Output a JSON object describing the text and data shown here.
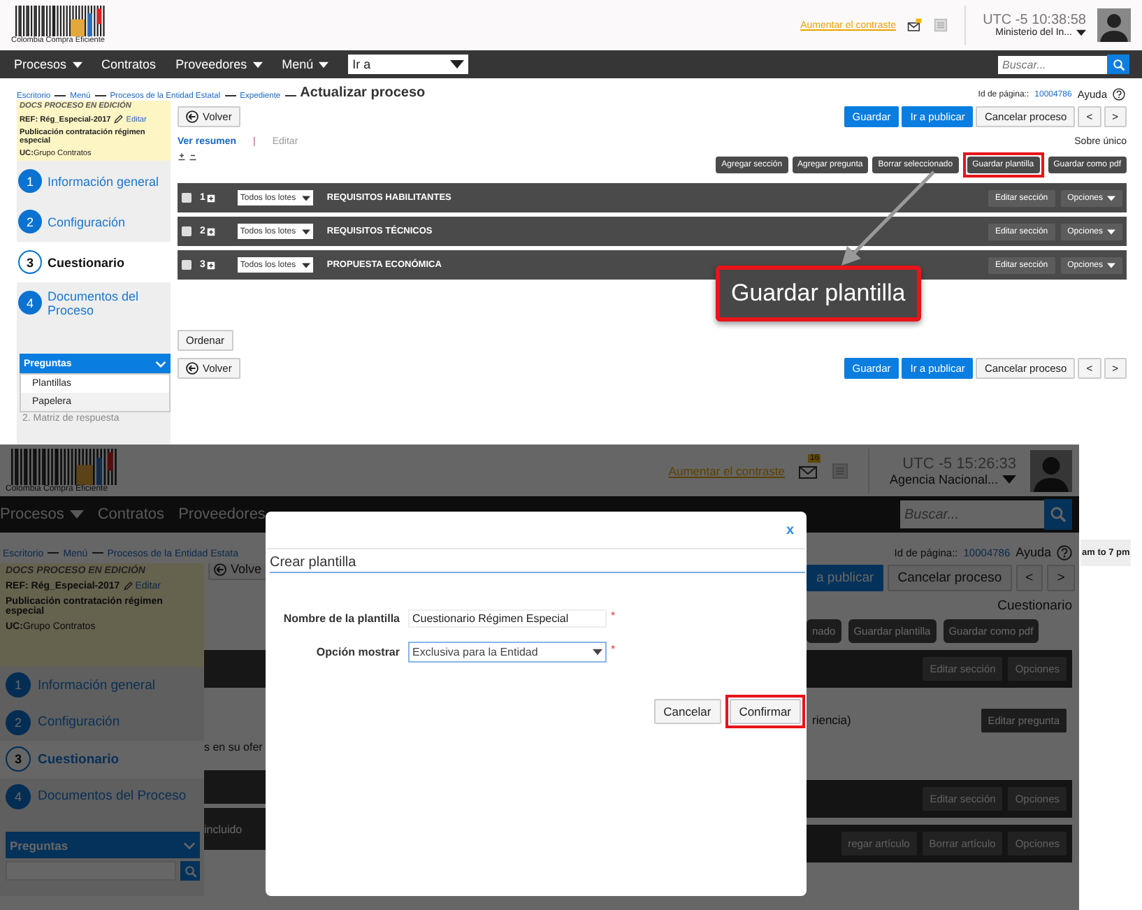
{
  "top": {
    "header": {
      "logo_text": "Colombia Compra Eficiente",
      "contrast_link": "Aumentar el contraste",
      "time": "UTC -5 10:38:58",
      "account": "Ministerio del In..."
    },
    "nav": {
      "items": [
        {
          "label": "Procesos",
          "dropdown": true
        },
        {
          "label": "Contratos",
          "dropdown": false
        },
        {
          "label": "Proveedores",
          "dropdown": true
        },
        {
          "label": "Menú",
          "dropdown": true
        }
      ],
      "goto": "Ir a",
      "search_placeholder": "Buscar..."
    },
    "breadcrumb": [
      "Escritorio",
      "Menú",
      "Procesos de la Entidad Estatal",
      "Expediente"
    ],
    "page_title": "Actualizar proceso",
    "page_id_label": "Id de página::",
    "page_id": "10004786",
    "help": "Ayuda",
    "process": {
      "status": "DOCS PROCESO EN EDICIÓN",
      "ref": "REF: Rég_Especial-2017",
      "edit": "Editar",
      "name": "Publicación contratación régimen especial",
      "unit_label": "UC:",
      "unit": "Grupo Contratos"
    },
    "steps": [
      {
        "number": "1",
        "label": "Información general",
        "selected": false
      },
      {
        "number": "2",
        "label": "Configuración",
        "selected": false
      },
      {
        "number": "3",
        "label": "Cuestionario",
        "selected": true
      },
      {
        "number": "4",
        "label": "Documentos del Proceso",
        "selected": false
      }
    ],
    "questions_menu": {
      "title": "Preguntas",
      "expanded": true,
      "items": [
        "Plantillas",
        "Papelera"
      ]
    },
    "hidden_step": "2. Matriz de respuesta",
    "back": "Volver",
    "actions": [
      {
        "label": "Guardar",
        "kind": "primary"
      },
      {
        "label": "Ir a publicar",
        "kind": "primary"
      },
      {
        "label": "Cancelar proceso",
        "kind": "default"
      },
      {
        "label": "<",
        "kind": "default"
      },
      {
        "label": ">",
        "kind": "default"
      }
    ],
    "view_links": [
      {
        "label": "Ver resumen",
        "disabled": false
      },
      {
        "label": "Editar",
        "disabled": true
      }
    ],
    "separator": "|",
    "envelope": "Sobre único",
    "toolbar": [
      {
        "label": "Agregar sección",
        "highlighted": false
      },
      {
        "label": "Agregar pregunta",
        "highlighted": false
      },
      {
        "label": "Borrar seleccionado",
        "highlighted": false
      },
      {
        "label": "Guardar plantilla",
        "highlighted": true
      },
      {
        "label": "Guardar como pdf",
        "highlighted": false
      }
    ],
    "sections": [
      {
        "number": "1",
        "checked": false,
        "lot": "Todos los lotes",
        "title": "REQUISITOS HABILITANTES",
        "edit": "Editar sección",
        "options": "Opciones"
      },
      {
        "number": "2",
        "checked": false,
        "lot": "Todos los lotes",
        "title": "REQUISITOS TÉCNICOS",
        "edit": "Editar sección",
        "options": "Opciones"
      },
      {
        "number": "3",
        "checked": false,
        "lot": "Todos los lotes",
        "title": "PROPUESTA ECONÓMICA",
        "edit": "Editar sección",
        "options": "Opciones"
      }
    ],
    "order": "Ordenar",
    "back_bottom": "Volver",
    "actions_bottom": [
      {
        "label": "Guardar",
        "kind": "primary"
      },
      {
        "label": "Ir a publicar",
        "kind": "primary"
      },
      {
        "label": "Cancelar proceso",
        "kind": "default"
      },
      {
        "label": "<",
        "kind": "default"
      },
      {
        "label": ">",
        "kind": "default"
      }
    ],
    "callout": "Guardar plantilla"
  },
  "bottom": {
    "header": {
      "logo_text": "Colombia Compra Eficiente",
      "contrast_link": "Aumentar el contraste",
      "badge": "16",
      "time": "UTC -5 15:26:33",
      "account": "Agencia Nacional..."
    },
    "nav": [
      {
        "label": "Procesos",
        "dropdown": true
      },
      {
        "label": "Contratos",
        "dropdown": false
      },
      {
        "label": "Proveedores",
        "dropdown": false
      }
    ],
    "search_placeholder": "Buscar...",
    "breadcrumb": [
      "Escritorio",
      "Menú",
      "Procesos de la Entidad Estata"
    ],
    "process": {
      "status": "DOCS PROCESO EN EDICIÓN",
      "ref": "REF: Rég_Especial-2017",
      "edit": "Editar",
      "name": "Publicación contratación régimen especial",
      "unit_label": "UC:",
      "unit": "Grupo Contratos"
    },
    "steps": [
      {
        "number": "1",
        "label": "Información general",
        "selected": false
      },
      {
        "number": "2",
        "label": "Configuración",
        "selected": false
      },
      {
        "number": "3",
        "label": "Cuestionario",
        "selected": true
      },
      {
        "number": "4",
        "label": "Documentos del Proceso",
        "selected": false
      }
    ],
    "questions_title": "Preguntas",
    "back": "Volve",
    "text_1": "s en su ofer",
    "text_2": "incluido",
    "page_id_label": "Id de página::",
    "page_id": "10004786",
    "help": "Ayuda",
    "hours": "am to 7 pm",
    "actions": [
      {
        "label": "a publicar",
        "kind": "primary"
      },
      {
        "label": "Cancelar proceso",
        "kind": "default"
      },
      {
        "label": "<",
        "kind": "default"
      },
      {
        "label": ">",
        "kind": "default"
      }
    ],
    "envelope": "Cuestionario",
    "toolbar": [
      "nado",
      "Guardar plantilla",
      "Guardar como pdf"
    ],
    "rows": [
      {
        "kind": "section",
        "buttons": [
          "Editar sección",
          "Opciones"
        ]
      },
      {
        "kind": "question",
        "text": "riencia)",
        "buttons": [
          "Editar pregunta"
        ]
      },
      {
        "kind": "section",
        "buttons": [
          "Editar sección",
          "Opciones"
        ]
      },
      {
        "kind": "article",
        "buttons": [
          "regar artículo",
          "Borrar artículo",
          "Opciones"
        ]
      }
    ],
    "modal": {
      "close": "x",
      "title": "Crear plantilla",
      "fields": [
        {
          "label": "Nombre de la plantilla",
          "kind": "text",
          "value": "Cuestionario Régimen Especial",
          "required_mark": "*"
        },
        {
          "label": "Opción mostrar",
          "kind": "select",
          "value": "Exclusiva para la Entidad",
          "required_mark": "*"
        }
      ],
      "buttons": [
        {
          "label": "Cancelar",
          "highlighted": false
        },
        {
          "label": "Confirmar",
          "highlighted": true
        }
      ]
    }
  }
}
